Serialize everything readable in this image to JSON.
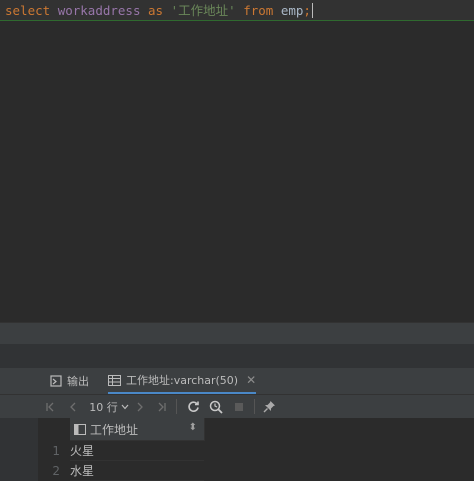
{
  "editor": {
    "sql": {
      "kw_select": "select",
      "column": "workaddress",
      "kw_as": "as",
      "alias": "'工作地址'",
      "kw_from": "from",
      "table": "emp",
      "terminator": ";"
    }
  },
  "tabs": [
    {
      "label": "输出",
      "icon": "output-icon"
    },
    {
      "label": "工作地址:varchar(50)",
      "icon": "table-grid-icon",
      "close": "✕"
    }
  ],
  "toolbar": {
    "first_page": "|<",
    "prev_page": "<",
    "page_size": "10 行",
    "next_page": ">",
    "last_page": ">|"
  },
  "grid": {
    "column_header": "工作地址",
    "sort_indicator": "⬍",
    "rows": [
      {
        "num": "1",
        "value": "火星"
      },
      {
        "num": "2",
        "value": "水星"
      }
    ]
  },
  "colors": {
    "keyword": "#cc7832",
    "identifier": "#9876aa",
    "string": "#6a8759",
    "background": "#2b2b2b",
    "tab_underline": "#4a88c7"
  }
}
